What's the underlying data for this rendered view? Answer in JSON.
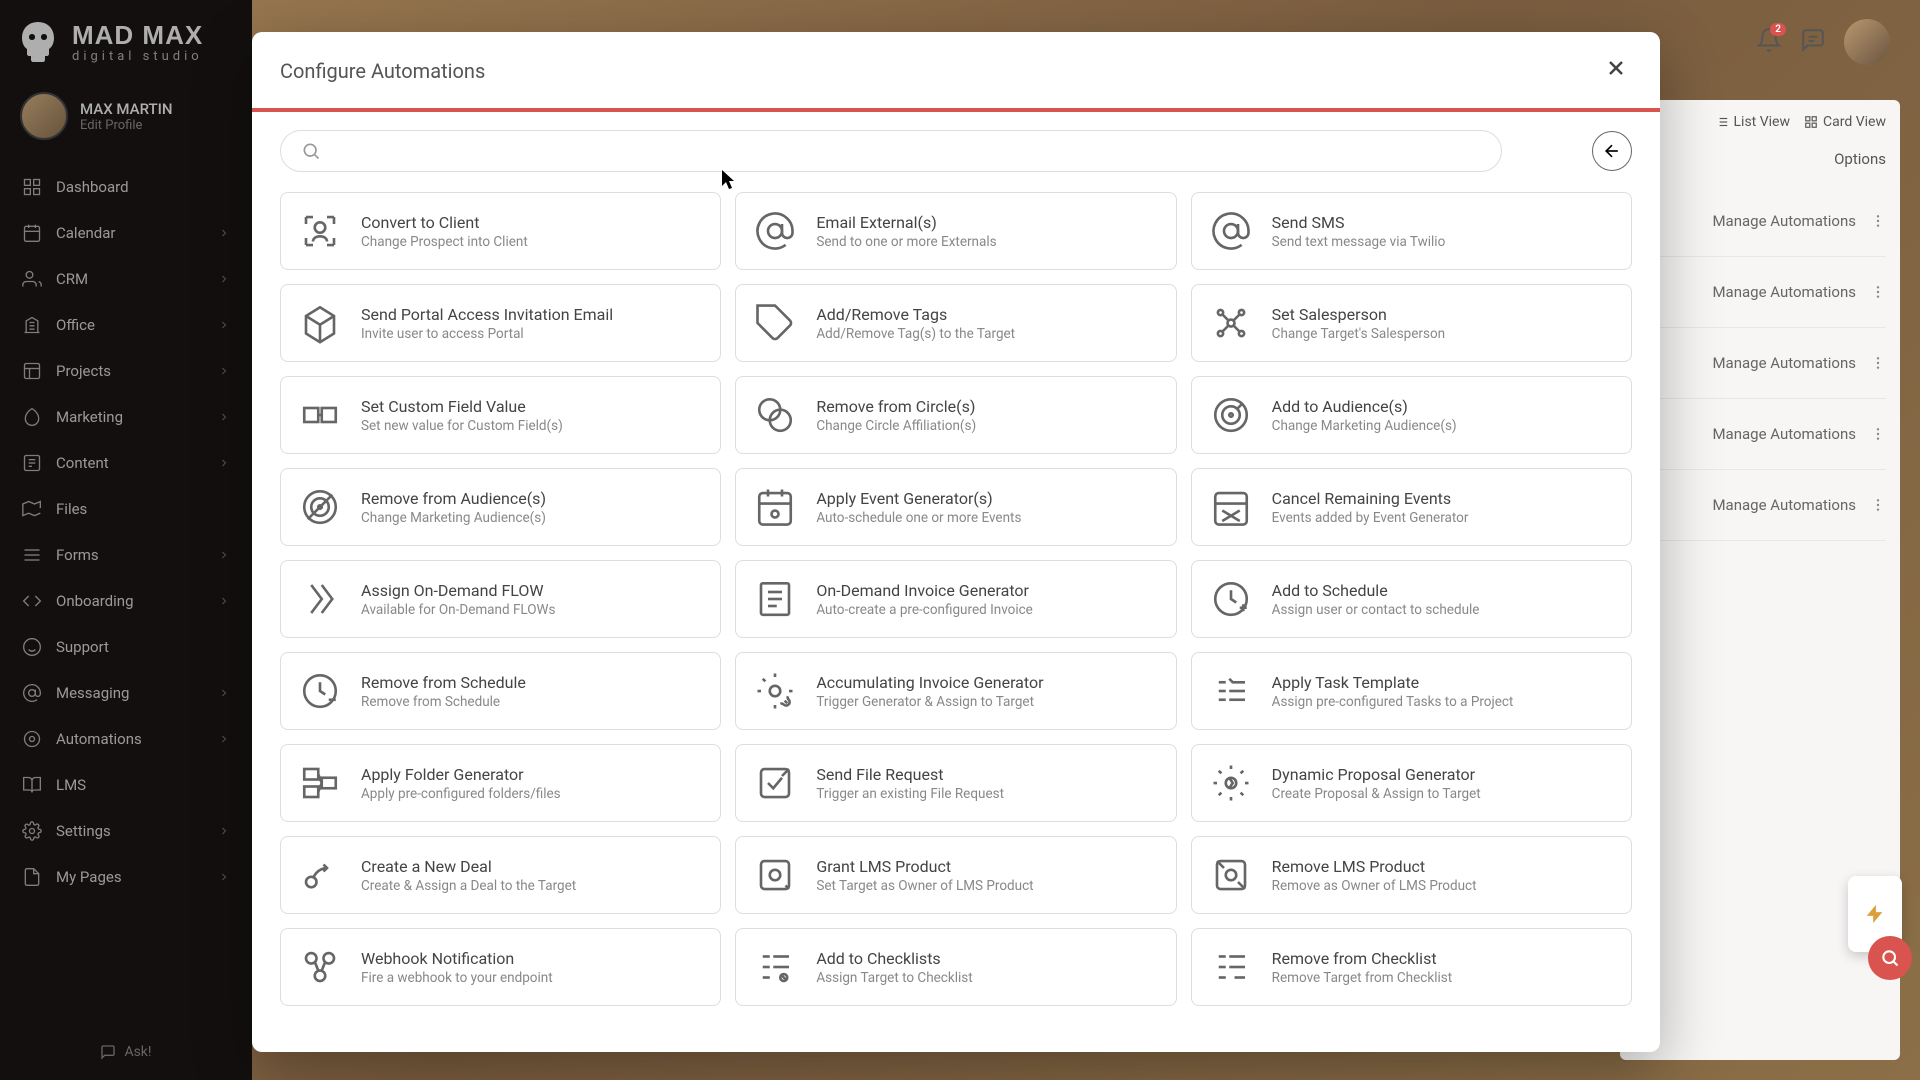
{
  "brand": {
    "title": "MAD MAX",
    "subtitle": "digital studio"
  },
  "profile": {
    "name": "MAX MARTIN",
    "edit": "Edit Profile"
  },
  "sidebar": {
    "items": [
      {
        "label": "Dashboard"
      },
      {
        "label": "Calendar"
      },
      {
        "label": "CRM"
      },
      {
        "label": "Office"
      },
      {
        "label": "Projects"
      },
      {
        "label": "Marketing"
      },
      {
        "label": "Content"
      },
      {
        "label": "Files"
      },
      {
        "label": "Forms"
      },
      {
        "label": "Onboarding"
      },
      {
        "label": "Support"
      },
      {
        "label": "Messaging"
      },
      {
        "label": "Automations"
      },
      {
        "label": "LMS"
      },
      {
        "label": "Settings"
      },
      {
        "label": "My Pages"
      }
    ],
    "ask": "Ask!"
  },
  "topbar": {
    "notif_count": "2"
  },
  "back_panel": {
    "list_view": "List View",
    "card_view": "Card View",
    "options": "Options",
    "manage": "Manage Automations"
  },
  "modal": {
    "title": "Configure Automations",
    "search_placeholder": "",
    "cards": [
      {
        "title": "Convert to Client",
        "desc": "Change Prospect into Client"
      },
      {
        "title": "Email External(s)",
        "desc": "Send to one or more Externals"
      },
      {
        "title": "Send SMS",
        "desc": "Send text message via Twilio"
      },
      {
        "title": "Send Portal Access Invitation Email",
        "desc": "Invite user to access Portal"
      },
      {
        "title": "Add/Remove Tags",
        "desc": "Add/Remove Tag(s) to the Target"
      },
      {
        "title": "Set Salesperson",
        "desc": "Change Target's Salesperson"
      },
      {
        "title": "Set Custom Field Value",
        "desc": "Set new value for Custom Field(s)"
      },
      {
        "title": "Remove from Circle(s)",
        "desc": "Change Circle Affiliation(s)"
      },
      {
        "title": "Add to Audience(s)",
        "desc": "Change Marketing Audience(s)"
      },
      {
        "title": "Remove from Audience(s)",
        "desc": "Change Marketing Audience(s)"
      },
      {
        "title": "Apply Event Generator(s)",
        "desc": "Auto-schedule one or more Events"
      },
      {
        "title": "Cancel Remaining Events",
        "desc": "Events added by Event Generator"
      },
      {
        "title": "Assign On-Demand FLOW",
        "desc": "Available for On-Demand FLOWs"
      },
      {
        "title": "On-Demand Invoice Generator",
        "desc": "Auto-create a pre-configured Invoice"
      },
      {
        "title": "Add to Schedule",
        "desc": "Assign user or contact to schedule"
      },
      {
        "title": "Remove from Schedule",
        "desc": "Remove from Schedule"
      },
      {
        "title": "Accumulating Invoice Generator",
        "desc": "Trigger Generator & Assign to Target"
      },
      {
        "title": "Apply Task Template",
        "desc": "Assign pre-configured Tasks to a Project"
      },
      {
        "title": "Apply Folder Generator",
        "desc": "Apply pre-configured folders/files"
      },
      {
        "title": "Send File Request",
        "desc": "Trigger an existing File Request"
      },
      {
        "title": "Dynamic Proposal Generator",
        "desc": "Create Proposal & Assign to Target"
      },
      {
        "title": "Create a New Deal",
        "desc": "Create & Assign a Deal to the Target"
      },
      {
        "title": "Grant LMS Product",
        "desc": "Set Target as Owner of LMS Product"
      },
      {
        "title": "Remove LMS Product",
        "desc": "Remove as Owner of LMS Product"
      },
      {
        "title": "Webhook Notification",
        "desc": "Fire a webhook to your endpoint"
      },
      {
        "title": "Add to Checklists",
        "desc": "Assign Target to Checklist"
      },
      {
        "title": "Remove from Checklist",
        "desc": "Remove Target from Checklist"
      }
    ]
  },
  "colors": {
    "accent": "#d9534f",
    "sidebar_bg": "#1a1414"
  }
}
